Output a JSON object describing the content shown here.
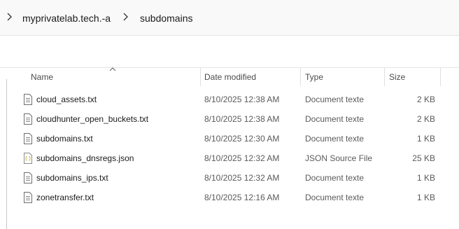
{
  "breadcrumb": {
    "items": [
      {
        "label": "myprivatelab.tech.-a"
      },
      {
        "label": "subdomains"
      }
    ]
  },
  "columns": {
    "name": "Name",
    "date": "Date modified",
    "type": "Type",
    "size": "Size",
    "sort_column": "Name",
    "sort_direction": "ascending"
  },
  "files": [
    {
      "name": "cloud_assets.txt",
      "date": "8/10/2025 12:38 AM",
      "type": "Document texte",
      "size": "2 KB",
      "icon": "text-file-icon"
    },
    {
      "name": "cloudhunter_open_buckets.txt",
      "date": "8/10/2025 12:38 AM",
      "type": "Document texte",
      "size": "2 KB",
      "icon": "text-file-icon"
    },
    {
      "name": "subdomains.txt",
      "date": "8/10/2025 12:30 AM",
      "type": "Document texte",
      "size": "1 KB",
      "icon": "text-file-icon"
    },
    {
      "name": "subdomains_dnsregs.json",
      "date": "8/10/2025 12:32 AM",
      "type": "JSON Source File",
      "size": "25 KB",
      "icon": "json-file-icon"
    },
    {
      "name": "subdomains_ips.txt",
      "date": "8/10/2025 12:32 AM",
      "type": "Document texte",
      "size": "1 KB",
      "icon": "text-file-icon"
    },
    {
      "name": "zonetransfer.txt",
      "date": "8/10/2025 12:16 AM",
      "type": "Document texte",
      "size": "1 KB",
      "icon": "text-file-icon"
    }
  ],
  "colors": {
    "addressbar_bg": "#f9f9f9",
    "text_primary": "#1a1a1a",
    "text_secondary": "#5a5a5a",
    "header_text": "#4c4c4c",
    "json_icon_accent": "#c9b24a"
  }
}
